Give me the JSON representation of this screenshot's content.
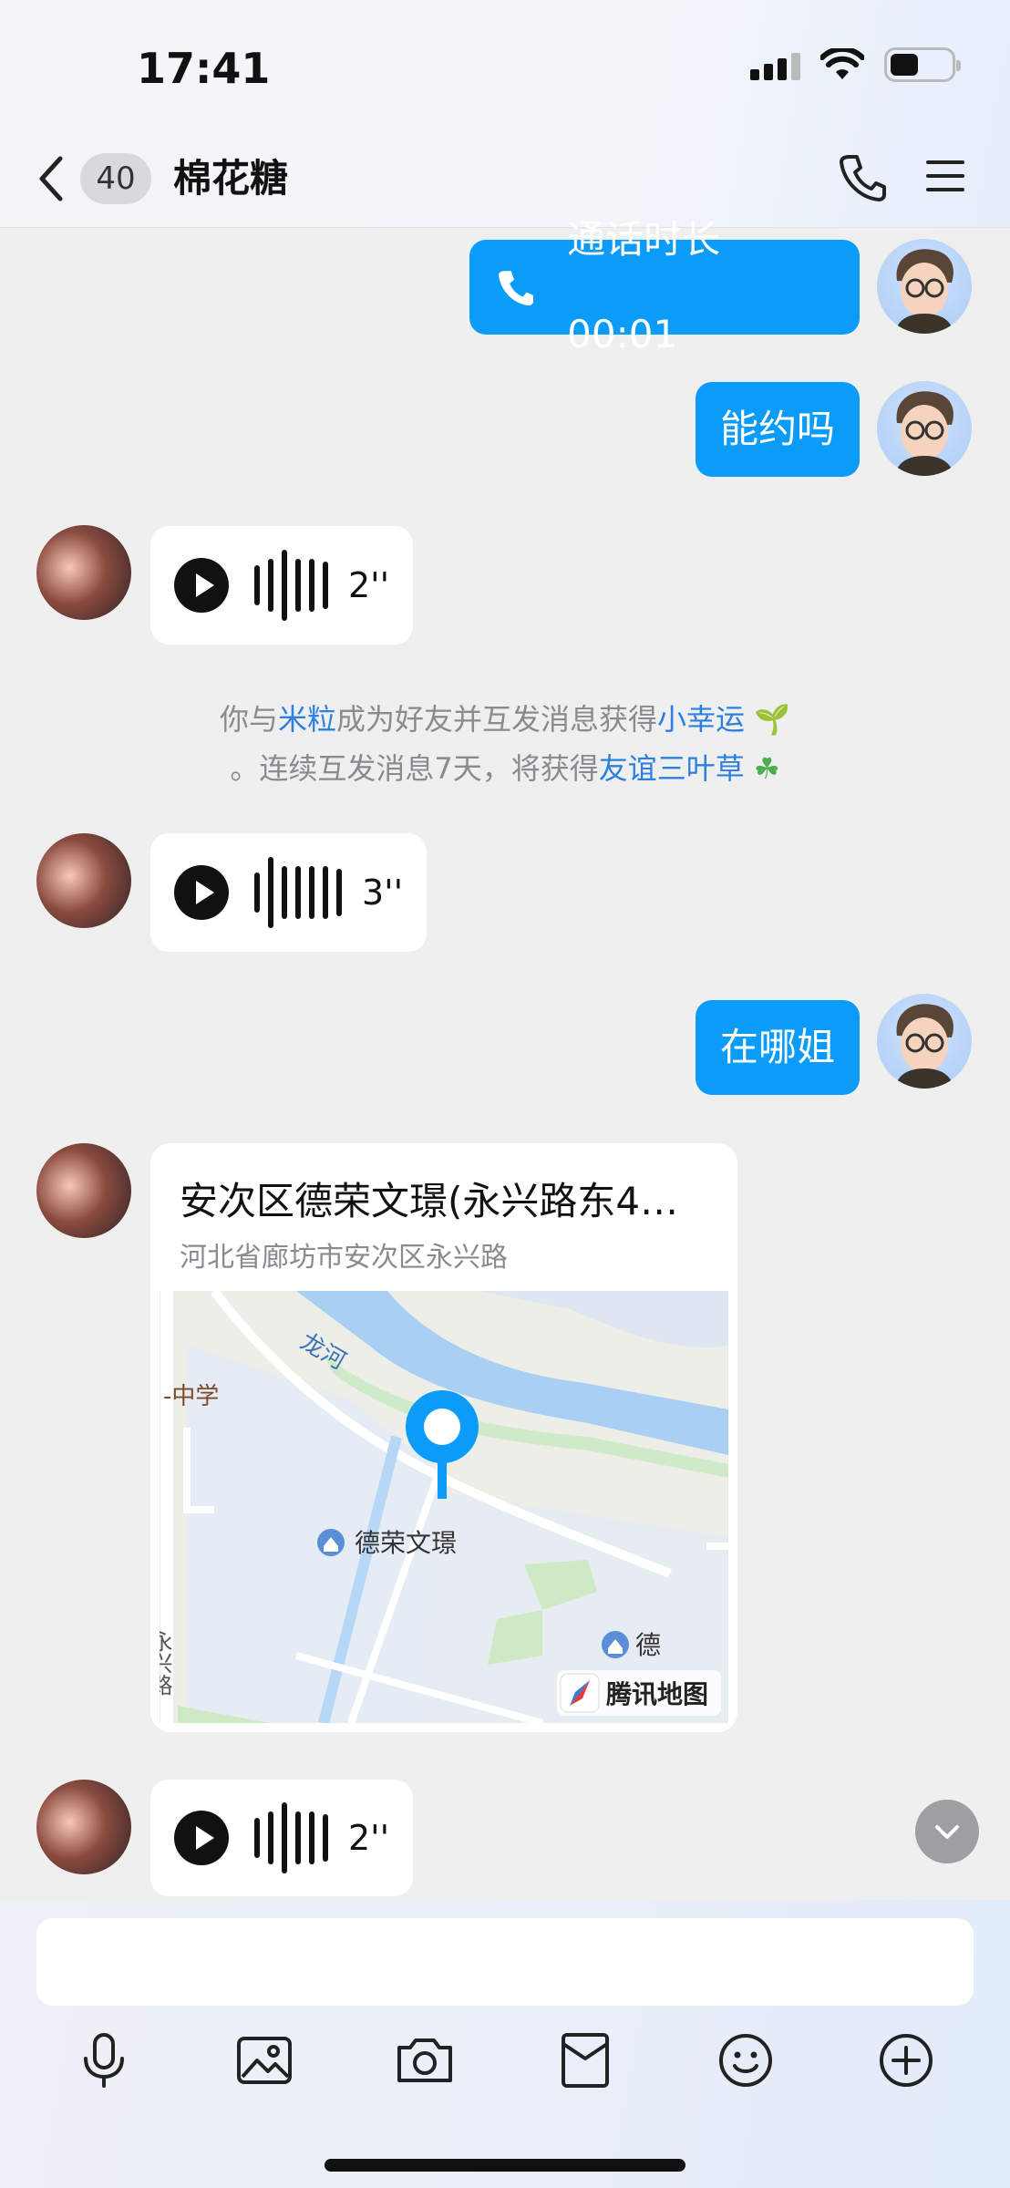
{
  "status": {
    "time": "17:41"
  },
  "header": {
    "unread_count": "40",
    "title": "棉花糖"
  },
  "messages": {
    "call": {
      "label": "通话时长 00:01"
    },
    "me1": {
      "text": "能约吗"
    },
    "voice1": {
      "duration": "2''"
    },
    "system": {
      "p1": "你与",
      "friend": "米粒",
      "p2": "成为好友并互发消息获得",
      "reward1": "小幸运",
      "p3": "。连续互发消息7天，将获得",
      "reward2": "友谊三叶草"
    },
    "voice2": {
      "duration": "3''"
    },
    "me2": {
      "text": "在哪姐"
    },
    "location": {
      "title": "安次区德荣文璟(永兴路东4…",
      "address": "河北省廊坊市安次区永兴路",
      "map_labels": {
        "river": "龙河",
        "school": "-中学",
        "poi": "德荣文璟",
        "road": "永兴路",
        "poi2": "德",
        "provider": "腾讯地图"
      }
    },
    "voice3": {
      "duration": "2''"
    }
  },
  "colors": {
    "accent": "#0b9cf9",
    "link": "#2d7fe0",
    "background": "#efeff0"
  },
  "icons": [
    "back-chevron-icon",
    "phone-icon",
    "menu-icon",
    "microphone-icon",
    "image-icon",
    "camera-icon",
    "red-packet-icon",
    "emoji-icon",
    "plus-icon",
    "chevron-down-icon"
  ]
}
